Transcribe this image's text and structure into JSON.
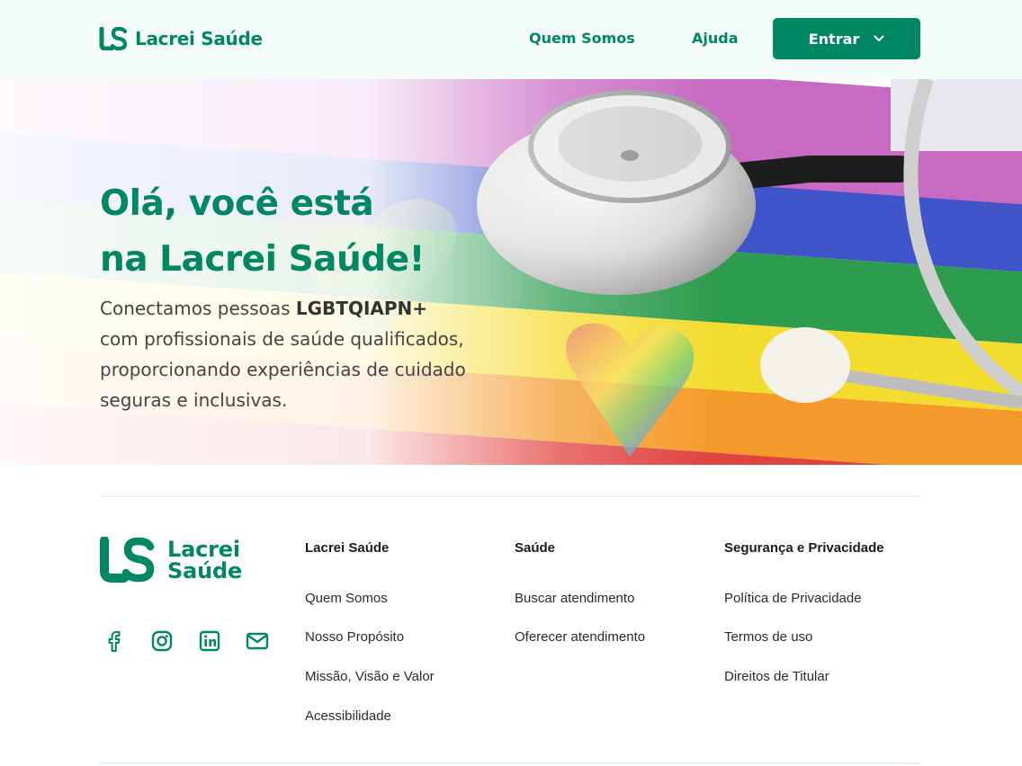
{
  "header": {
    "brand": "Lacrei Saúde",
    "nav": {
      "about": "Quem Somos",
      "help": "Ajuda"
    },
    "login_button": "Entrar"
  },
  "hero": {
    "title_line1": "Olá, você está",
    "title_line2": "na Lacrei Saúde!",
    "text_lead": "Conectamos pessoas ",
    "text_highlight": "LGBTQIAPN+",
    "text_line2": "com profissionais de saúde qualificados,",
    "text_line3": "proporcionando experiências de cuidado",
    "text_line4": "seguras e inclusivas."
  },
  "footer": {
    "brand_line1": "Lacrei",
    "brand_line2": "Saúde",
    "social_icons": [
      "facebook-icon",
      "instagram-icon",
      "linkedin-icon",
      "mail-icon"
    ],
    "columns": [
      {
        "title": "Lacrei Saúde",
        "links": [
          "Quem Somos",
          "Nosso Propósito",
          "Missão, Visão e Valor",
          "Acessibilidade"
        ]
      },
      {
        "title": "Saúde",
        "links": [
          "Buscar atendimento",
          "Oferecer atendimento"
        ]
      },
      {
        "title": "Segurança e Privacidade",
        "links": [
          "Política de Privacidade",
          "Termos de uso",
          "Direitos de Titular"
        ]
      }
    ]
  },
  "colors": {
    "brand": "#018762",
    "header_bg": "#f3fcf9",
    "divider": "#e1f2ec"
  }
}
